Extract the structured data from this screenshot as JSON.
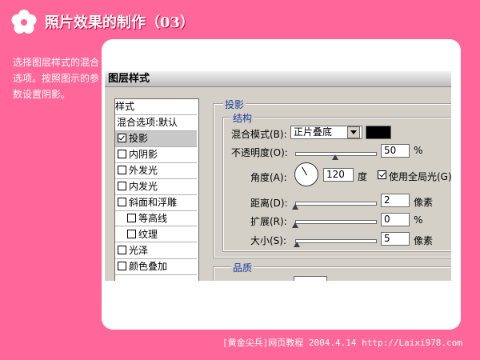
{
  "slide": {
    "title": "照片效果的制作（03）",
    "instruction": "选择图层样式的混合选项。按照图示的参数设置阴影。",
    "footer": "[黄金尖兵]网页教程 2004.4.14 http://Laixi978.com"
  },
  "dialog": {
    "title": "图层样式",
    "style_list": {
      "header": "样式",
      "items": [
        {
          "label": "混合选项:默认",
          "checkbox": false,
          "checked": false,
          "selected": false,
          "indent": false
        },
        {
          "label": "投影",
          "checkbox": true,
          "checked": true,
          "selected": true,
          "indent": false
        },
        {
          "label": "内阴影",
          "checkbox": true,
          "checked": false,
          "selected": false,
          "indent": false
        },
        {
          "label": "外发光",
          "checkbox": true,
          "checked": false,
          "selected": false,
          "indent": false
        },
        {
          "label": "内发光",
          "checkbox": true,
          "checked": false,
          "selected": false,
          "indent": false
        },
        {
          "label": "斜面和浮雕",
          "checkbox": true,
          "checked": false,
          "selected": false,
          "indent": false
        },
        {
          "label": "等高线",
          "checkbox": true,
          "checked": false,
          "selected": false,
          "indent": true
        },
        {
          "label": "纹理",
          "checkbox": true,
          "checked": false,
          "selected": false,
          "indent": true
        },
        {
          "label": "光泽",
          "checkbox": true,
          "checked": false,
          "selected": false,
          "indent": false
        },
        {
          "label": "颜色叠加",
          "checkbox": true,
          "checked": false,
          "selected": false,
          "indent": false
        }
      ]
    },
    "drop_shadow": {
      "section_title": "投影",
      "structure_title": "结构",
      "blend_mode_label": "混合模式(B):",
      "blend_mode_value": "正片叠底",
      "shadow_color": "#000000",
      "opacity_label": "不透明度(O):",
      "opacity_value": "50",
      "opacity_unit": "%",
      "opacity_level": 0.5,
      "angle_label": "角度(A):",
      "angle_value": "120",
      "angle_unit": "度",
      "global_light_label": "使用全局光(G)",
      "global_light_checked": true,
      "distance_label": "距离(D):",
      "distance_value": "2",
      "distance_unit": "像素",
      "distance_level": 0.0,
      "spread_label": "扩展(R):",
      "spread_value": "0",
      "spread_unit": "%",
      "spread_level": 0.0,
      "size_label": "大小(S):",
      "size_value": "5",
      "size_unit": "像素",
      "size_level": 0.02,
      "quality_title": "品质"
    }
  }
}
